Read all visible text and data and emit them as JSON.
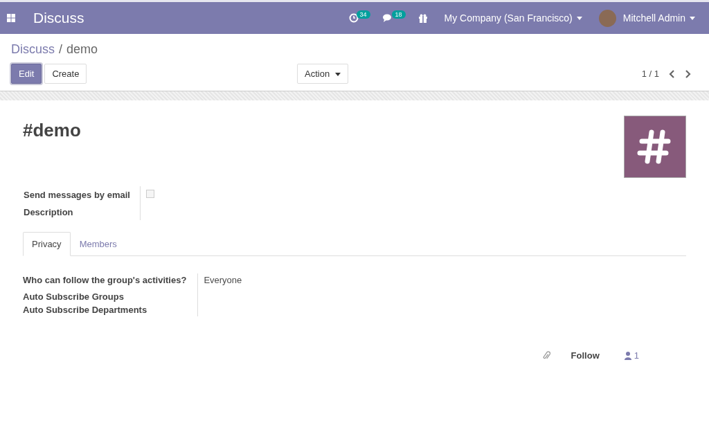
{
  "navbar": {
    "app_title": "Discuss",
    "activity_count": "34",
    "message_count": "18",
    "company": "My Company (San Francisco)",
    "user": "Mitchell Admin"
  },
  "breadcrumb": [
    {
      "label": "Discuss",
      "link": true
    },
    {
      "label": "demo",
      "link": false
    }
  ],
  "breadcrumb_separator": "/",
  "buttons": [
    {
      "label": "Edit",
      "primary": true
    },
    {
      "label": "Create",
      "primary": false
    }
  ],
  "action": "Action",
  "pager": "1 / 1",
  "record": {
    "title": "#demo",
    "fields": [
      {
        "label": "Send messages by email",
        "kind": "checkbox",
        "checked": false
      },
      {
        "label": "Description",
        "kind": "text"
      }
    ],
    "tabs": [
      {
        "label": "Privacy",
        "selected": true
      },
      {
        "label": "Members",
        "selected": false
      }
    ],
    "privacy_fields": [
      {
        "label": "Who can follow the group's activities?",
        "value": "Everyone"
      },
      {
        "label": "Auto Subscribe Groups"
      },
      {
        "label": "Auto Subscribe Departments"
      }
    ]
  },
  "chatter": {
    "follow": "Follow",
    "followers": "1"
  }
}
